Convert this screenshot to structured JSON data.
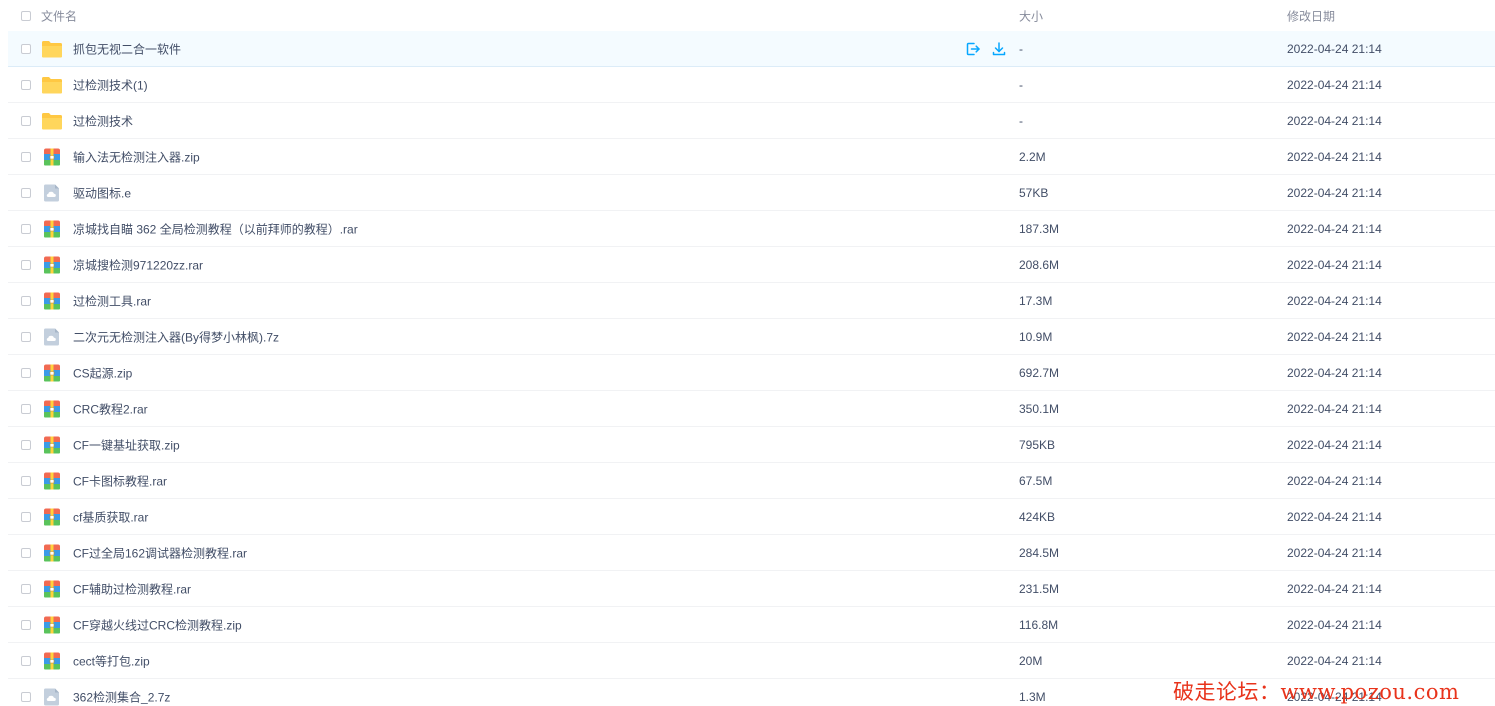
{
  "header": {
    "name_label": "文件名",
    "size_label": "大小",
    "date_label": "修改日期"
  },
  "files": [
    {
      "name": "抓包无视二合一软件",
      "size": "-",
      "date": "2022-04-24 21:14",
      "icon": "folder-icon"
    },
    {
      "name": "过检测技术(1)",
      "size": "-",
      "date": "2022-04-24 21:14",
      "icon": "folder-icon"
    },
    {
      "name": "过检测技术",
      "size": "-",
      "date": "2022-04-24 21:14",
      "icon": "folder-icon"
    },
    {
      "name": "输入法无检测注入器.zip",
      "size": "2.2M",
      "date": "2022-04-24 21:14",
      "icon": "archive-icon"
    },
    {
      "name": "驱动图标.e",
      "size": "57KB",
      "date": "2022-04-24 21:14",
      "icon": "cloud-file-icon"
    },
    {
      "name": "凉城找自瞄 362 全局检测教程（以前拜师的教程）.rar",
      "size": "187.3M",
      "date": "2022-04-24 21:14",
      "icon": "archive-icon"
    },
    {
      "name": "凉城搜检测971220zz.rar",
      "size": "208.6M",
      "date": "2022-04-24 21:14",
      "icon": "archive-icon"
    },
    {
      "name": "过检测工具.rar",
      "size": "17.3M",
      "date": "2022-04-24 21:14",
      "icon": "archive-icon"
    },
    {
      "name": "二次元无检测注入器(By得梦小林枫).7z",
      "size": "10.9M",
      "date": "2022-04-24 21:14",
      "icon": "cloud-file-icon"
    },
    {
      "name": "CS起源.zip",
      "size": "692.7M",
      "date": "2022-04-24 21:14",
      "icon": "archive-icon"
    },
    {
      "name": "CRC教程2.rar",
      "size": "350.1M",
      "date": "2022-04-24 21:14",
      "icon": "archive-icon"
    },
    {
      "name": "CF一键基址获取.zip",
      "size": "795KB",
      "date": "2022-04-24 21:14",
      "icon": "archive-icon"
    },
    {
      "name": "CF卡图标教程.rar",
      "size": "67.5M",
      "date": "2022-04-24 21:14",
      "icon": "archive-icon"
    },
    {
      "name": "cf基质获取.rar",
      "size": "424KB",
      "date": "2022-04-24 21:14",
      "icon": "archive-icon"
    },
    {
      "name": "CF过全局162调试器检测教程.rar",
      "size": "284.5M",
      "date": "2022-04-24 21:14",
      "icon": "archive-icon"
    },
    {
      "name": "CF辅助过检测教程.rar",
      "size": "231.5M",
      "date": "2022-04-24 21:14",
      "icon": "archive-icon"
    },
    {
      "name": "CF穿越火线过CRC检测教程.zip",
      "size": "116.8M",
      "date": "2022-04-24 21:14",
      "icon": "archive-icon"
    },
    {
      "name": "cect等打包.zip",
      "size": "20M",
      "date": "2022-04-24 21:14",
      "icon": "archive-icon"
    },
    {
      "name": "362检测集合_2.7z",
      "size": "1.3M",
      "date": "2022-04-24 21:14",
      "icon": "cloud-file-icon"
    }
  ],
  "hover_row_index": 0,
  "row_actions": [
    "share-icon",
    "download-icon"
  ],
  "watermark": "破走论坛：www.pozou.com",
  "colors": {
    "accent": "#06a7ff",
    "folder": "#ffc843",
    "text": "#424e67",
    "muted": "#878c9c",
    "watermark": "#e8331b"
  }
}
